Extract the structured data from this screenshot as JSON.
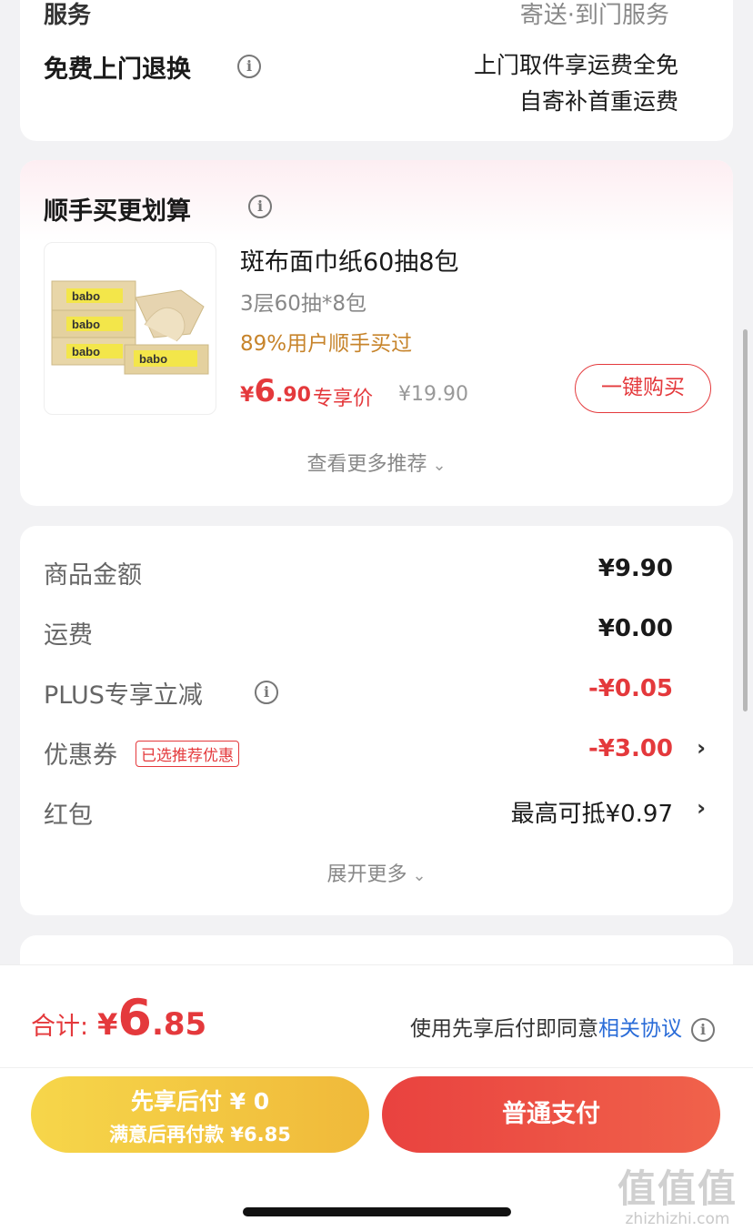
{
  "return_card": {
    "cut_left": "服务",
    "cut_right": "寄送·到门服务",
    "title": "免费上门退换",
    "line1": "上门取件享运费全免",
    "line2": "自寄补首重运费"
  },
  "recommend": {
    "title": "顺手买更划算",
    "product": {
      "name": "斑布面巾纸60抽8包",
      "spec": "3层60抽*8包",
      "bought": "89%用户顺手买过",
      "price_yen": "¥",
      "price_int": "6",
      "price_dec": ".90",
      "price_tag": "专享价",
      "original_price": "¥19.90",
      "buy_button": "一键购买",
      "image_brand_text": "babo"
    },
    "more": "查看更多推荐"
  },
  "summary": {
    "rows": [
      {
        "label": "商品金额",
        "value": "¥9.90"
      },
      {
        "label": "运费",
        "value": "¥0.00"
      },
      {
        "label": "PLUS专享立减",
        "value": "-¥0.05"
      },
      {
        "label": "优惠券",
        "badge": "已选推荐优惠",
        "value": "-¥3.00"
      },
      {
        "label": "红包",
        "value": "最高可抵¥0.97"
      }
    ],
    "expand": "展开更多"
  },
  "bottom": {
    "total_label": "合计:",
    "total_yen": "¥",
    "total_int": "6",
    "total_dec": ".85",
    "agree_text": "使用先享后付即同意",
    "agree_link": "相关协议",
    "pay_later_line1": "先享后付 ¥ 0",
    "pay_later_line2": "满意后再付款 ¥6.85",
    "pay_button": "普通支付"
  },
  "watermark": {
    "logo": "值值值",
    "site": "zhizhizhi.com"
  },
  "colors": {
    "accent_red": "#e4393c",
    "gold": "#c7842b",
    "link_blue": "#2a6cd8",
    "pay_later_yellow": "#f2c53f"
  },
  "icons": {
    "info": "info-icon",
    "chevron_down": "chevron-down-icon",
    "chevron_right": "chevron-right-icon"
  }
}
